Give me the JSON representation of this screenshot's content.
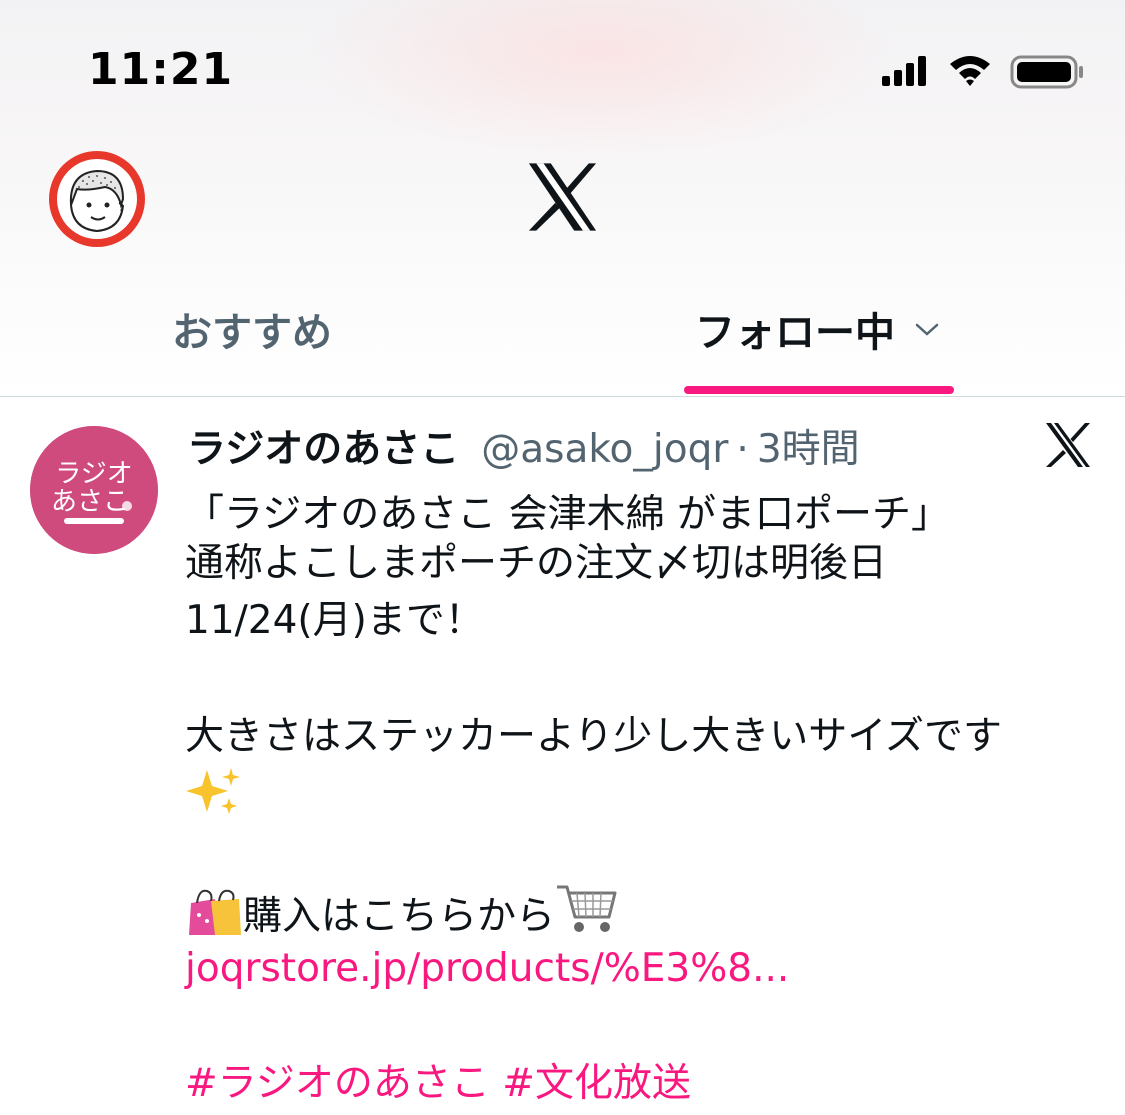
{
  "status_bar": {
    "time": "11:21",
    "icons": [
      "signal-icon",
      "wifi-icon",
      "battery-icon"
    ]
  },
  "header": {
    "logo": "x-logo-icon",
    "avatar_icon": "profile-avatar-icon"
  },
  "tabs": [
    {
      "label": "おすすめ",
      "active": false
    },
    {
      "label": "フォロー中",
      "active": true
    }
  ],
  "tweet": {
    "author_name": "ラジオのあさこ",
    "handle": "@asako_joqr",
    "separator": "·",
    "time": "3時間",
    "avatar_text": [
      "ラジオ",
      "あさこ"
    ],
    "lines": [
      "「ラジオのあさこ 会津木綿 がま口ポーチ」",
      "通称よこしまポーチの注文〆切は明後日",
      "11/24(月)まで！",
      "大きさはステッカーより少し大きいサイズです",
      "購入はこちらから"
    ],
    "link": "joqrstore.jp/products/%E3%8...",
    "hashtags": "#ラジオのあさこ #文化放送"
  },
  "colors": {
    "accent": "#f91880",
    "text": "#0f1419",
    "secondary": "#536471",
    "avatar_ring": "#e8382c"
  }
}
